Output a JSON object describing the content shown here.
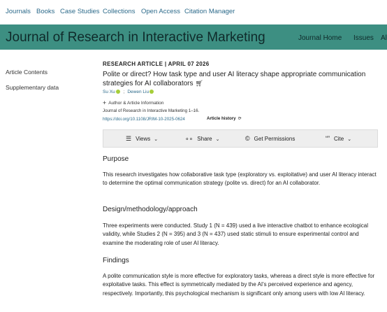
{
  "topnav": {
    "items": [
      "Journals",
      "Books",
      "Case Studies",
      "Collections",
      "Open Access",
      "Citation Manager"
    ]
  },
  "banner": {
    "journal_title": "Journal of Research in Interactive Marketing",
    "links": [
      "Journal Home",
      "Issues",
      "Al"
    ]
  },
  "sidebar": {
    "items": [
      "Article Contents",
      "Supplementary data"
    ]
  },
  "article": {
    "type_label": "RESEARCH ARTICLE",
    "date": "APRIL 07 2026",
    "title": "Polite or direct? How task type and user AI literacy shape appropriate communication strategies for AI collaborators",
    "authors": [
      "Su Xu",
      "Dewen Liu"
    ],
    "author_info_label": "Author & Article Information",
    "citation": "Journal of Research in Interactive Marketing 1–16.",
    "doi": "https://doi.org/10.1108/JRIM-10-2025-0624",
    "history_label": "Article history"
  },
  "actions": {
    "views": "Views",
    "share": "Share",
    "permissions": "Get Permissions",
    "cite": "Cite"
  },
  "sections": [
    {
      "heading": "Purpose",
      "body": "This research investigates how collaborative task type (exploratory vs. exploitative) and user AI literacy interact to determine the optimal communication strategy (polite vs. direct) for an AI collaborator."
    },
    {
      "heading": "Design/methodology/approach",
      "body": "Three experiments were conducted. Study 1 (N = 439) used a live interactive chatbot to enhance ecological validity, while Studies 2 (N = 395) and 3 (N = 437) used static stimuli to ensure experimental control and examine the moderating role of user AI literacy."
    },
    {
      "heading": "Findings",
      "body": "A polite communication style is more effective for exploratory tasks, whereas a direct style is more effective for exploitative tasks. This effect is symmetrically mediated by the AI's perceived experience and agency, respectively. Importantly, this psychological mechanism is significant only among users with low AI literacy."
    }
  ],
  "colors": {
    "banner": "#3d8f82",
    "link": "#2c6a8a",
    "orcid": "#a6ce39"
  }
}
